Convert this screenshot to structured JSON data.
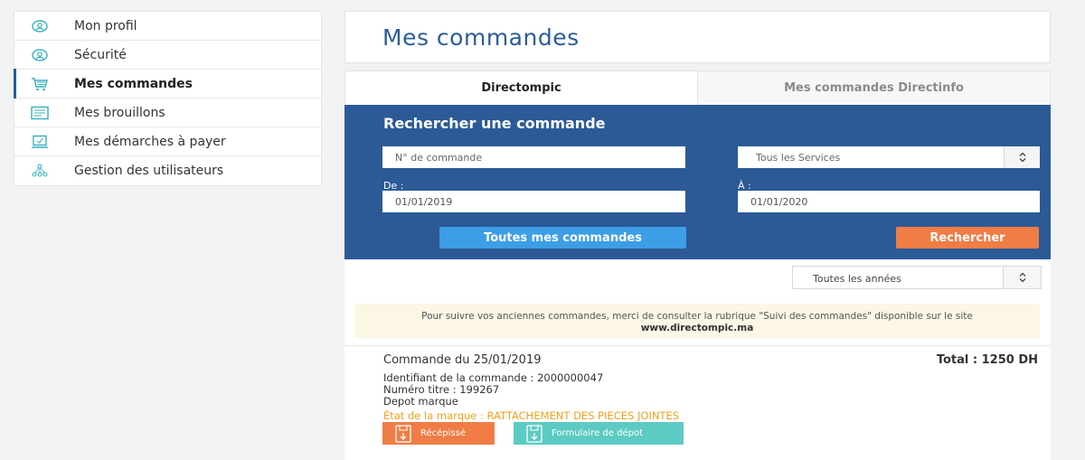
{
  "sidebar": {
    "items": [
      {
        "label": "Mon profil",
        "icon": "profile-icon"
      },
      {
        "label": "Sécurité",
        "icon": "security-icon"
      },
      {
        "label": "Mes commandes",
        "icon": "cart-icon",
        "active": true
      },
      {
        "label": "Mes brouillons",
        "icon": "drafts-icon"
      },
      {
        "label": "Mes démarches à payer",
        "icon": "laptop-payment-icon"
      },
      {
        "label": "Gestion des utilisateurs",
        "icon": "users-network-icon"
      }
    ]
  },
  "header": {
    "title": "Mes commandes"
  },
  "tabs": [
    {
      "label": "Directompic",
      "active": true
    },
    {
      "label": "Mes commandes Directinfo",
      "active": false
    }
  ],
  "search": {
    "title": "Rechercher une commande",
    "order_number_placeholder": "N° de commande",
    "service_select_value": "Tous les Services",
    "from_label": "De :",
    "from_value": "01/01/2019",
    "to_label": "À :",
    "to_value": "01/01/2020",
    "all_orders_button": "Toutes mes commandes",
    "search_button": "Rechercher"
  },
  "filters": {
    "year_select_value": "Toutes les années"
  },
  "notice": {
    "text": "Pour suivre vos anciennes commandes, merci de consulter la rubrique \"Suivi des commandes\" disponible sur le site ",
    "link": "www.directompic.ma"
  },
  "order": {
    "title": "Commande du 25/01/2019",
    "total": "Total : 1250 DH",
    "identifier": "Identifiant de la commande : 2000000047",
    "title_number": "Numéro titre : 199267",
    "type": "Depot marque",
    "state": "État de la marque : RATTACHEMENT DES PIECES JOINTES",
    "receipt_button": "Récépissé",
    "form_button": "Formulaire de dépot"
  },
  "colors": {
    "primary_blue": "#2b5a96",
    "light_blue_button": "#3d9ee6",
    "orange_button": "#ef7d45",
    "teal_button": "#5ccbc3",
    "state_orange": "#f0a01e",
    "icon_teal": "#36b0bd"
  }
}
